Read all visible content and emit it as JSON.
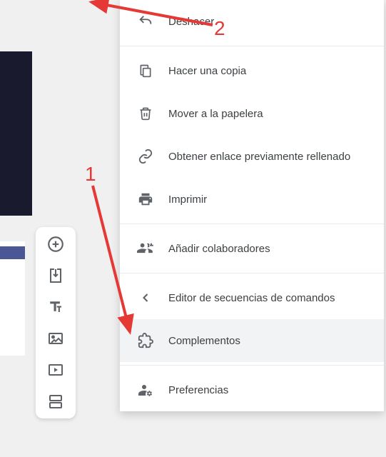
{
  "menu": {
    "items": [
      {
        "id": "undo",
        "label": "Deshacer",
        "icon": "undo-icon"
      },
      {
        "id": "copy",
        "label": "Hacer una copia",
        "icon": "copy-icon"
      },
      {
        "id": "trash",
        "label": "Mover a la papelera",
        "icon": "trash-icon"
      },
      {
        "id": "link",
        "label": "Obtener enlace previamente rellenado",
        "icon": "link-icon"
      },
      {
        "id": "print",
        "label": "Imprimir",
        "icon": "print-icon"
      },
      {
        "id": "collaborators",
        "label": "Añadir colaboradores",
        "icon": "people-add-icon"
      },
      {
        "id": "script",
        "label": "Editor de secuencias de comandos",
        "icon": "chevron-left-icon"
      },
      {
        "id": "addons",
        "label": "Complementos",
        "icon": "puzzle-icon",
        "highlighted": true
      },
      {
        "id": "preferences",
        "label": "Preferencias",
        "icon": "person-gear-icon"
      }
    ]
  },
  "toolbar": {
    "items": [
      {
        "id": "add",
        "icon": "add-circle-icon"
      },
      {
        "id": "import",
        "icon": "import-icon"
      },
      {
        "id": "text",
        "icon": "text-icon"
      },
      {
        "id": "image",
        "icon": "image-icon"
      },
      {
        "id": "video",
        "icon": "video-icon"
      },
      {
        "id": "section",
        "icon": "section-icon"
      }
    ]
  },
  "annotations": {
    "label1": "1",
    "label2": "2"
  }
}
